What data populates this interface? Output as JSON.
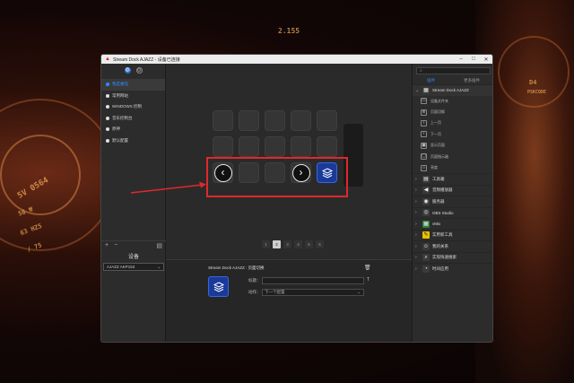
{
  "window": {
    "title": "Stream Dock AJAZZ - 设备已连接"
  },
  "wallpaper": {
    "numbers": [
      "2.155",
      "5V 0564",
      "56 ₩",
      "63 HZ5",
      "/ 75",
      "D4",
      "PSKCODE"
    ]
  },
  "sidebar": {
    "tabs": [
      {
        "icon": "globe-icon",
        "active": true
      },
      {
        "icon": "settings-icon",
        "active": false
      }
    ],
    "profiles": [
      {
        "label": "我是番茄",
        "active": true
      },
      {
        "label": "常用网站",
        "active": false
      },
      {
        "label": "WINDOWS 控制",
        "active": false
      },
      {
        "label": "音乐控制台",
        "active": false
      },
      {
        "label": "原神",
        "active": false
      },
      {
        "label": "默认配置",
        "active": false
      }
    ],
    "add_label": "+",
    "remove_label": "−",
    "device_title": "设备",
    "device_value": "AJAZZ AKP153"
  },
  "deck": {
    "pages": [
      "1",
      "2",
      "3",
      "4",
      "5",
      "6"
    ],
    "active_page": "2"
  },
  "detail": {
    "title": "Stream Dock AJAZZ : 页面切换",
    "title_field_label": "标题：",
    "title_field_value": "",
    "title_format_icon": "T",
    "action_field_label": "动作：",
    "action_field_value": "下一个配置"
  },
  "right_panel": {
    "search_placeholder": "",
    "tabs": [
      "插件",
      "更多插件"
    ],
    "group_open": {
      "label": "Stream Dock AJAZZ",
      "items": [
        "设备文件夹",
        "页面切换",
        "上一页",
        "下一页",
        "显示页面",
        "页面指示器",
        "亮度"
      ]
    },
    "groups": [
      "工具箱",
      "音频播放器",
      "服务器",
      "OBS Studio",
      "vMix",
      "实用新工具",
      "我的关系",
      "实现快速搜索",
      "时间应用"
    ]
  },
  "colors": {
    "accent": "#2a8cff",
    "highlight_red": "#e0282c",
    "key_blue": "#1a3a9a"
  }
}
